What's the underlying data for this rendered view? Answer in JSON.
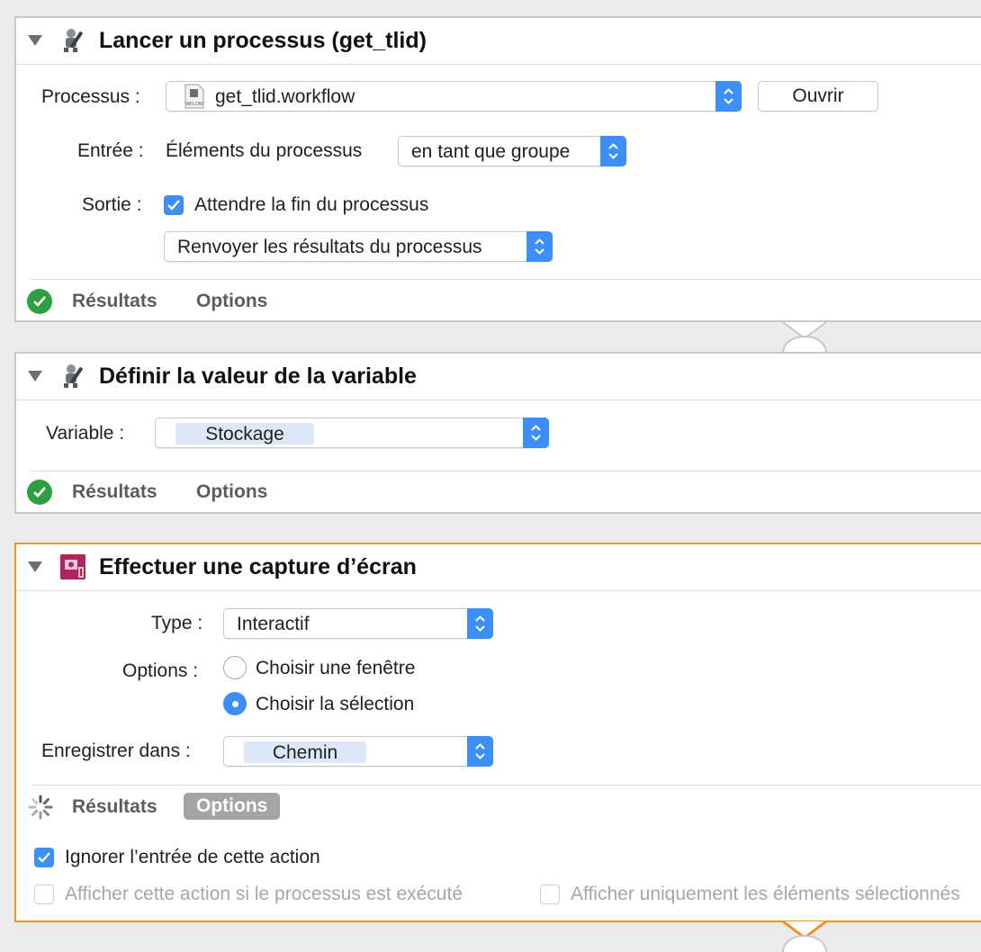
{
  "colors": {
    "accent": "#3d8ef7",
    "selection_border": "#f39321",
    "success": "#2ea043"
  },
  "actions": [
    {
      "title": "Lancer un processus (get_tlid)",
      "icon": "automator-robot-icon",
      "process_label": "Processus :",
      "process_value": "get_tlid.workflow",
      "process_file_badge": "WFLOW",
      "open_button": "Ouvrir",
      "input_label": "Entrée :",
      "input_text": "Éléments du processus",
      "input_mode": "en tant que groupe",
      "output_label": "Sortie :",
      "wait_checkbox": "Attendre la fin du processus",
      "wait_checked": true,
      "return_popup": "Renvoyer les résultats du processus",
      "tab_results": "Résultats",
      "tab_options": "Options"
    },
    {
      "title": "Définir la valeur de la variable",
      "icon": "automator-robot-icon",
      "variable_label": "Variable :",
      "variable_value": "Stockage",
      "tab_results": "Résultats",
      "tab_options": "Options"
    },
    {
      "title": "Effectuer une capture d’écran",
      "icon": "screenshot-icon",
      "type_label": "Type :",
      "type_value": "Interactif",
      "options_label": "Options :",
      "radio_window": "Choisir une fenêtre",
      "radio_selection": "Choisir la sélection",
      "selected_radio": "Choisir la sélection",
      "save_label": "Enregistrer dans :",
      "save_value": "Chemin",
      "tab_results": "Résultats",
      "tab_options": "Options",
      "ignore_input": "Ignorer l’entrée de cette action",
      "ignore_input_checked": true,
      "show_when_run": "Afficher cette action si le processus est exécuté",
      "show_selected_only": "Afficher uniquement les éléments sélectionnés"
    }
  ]
}
